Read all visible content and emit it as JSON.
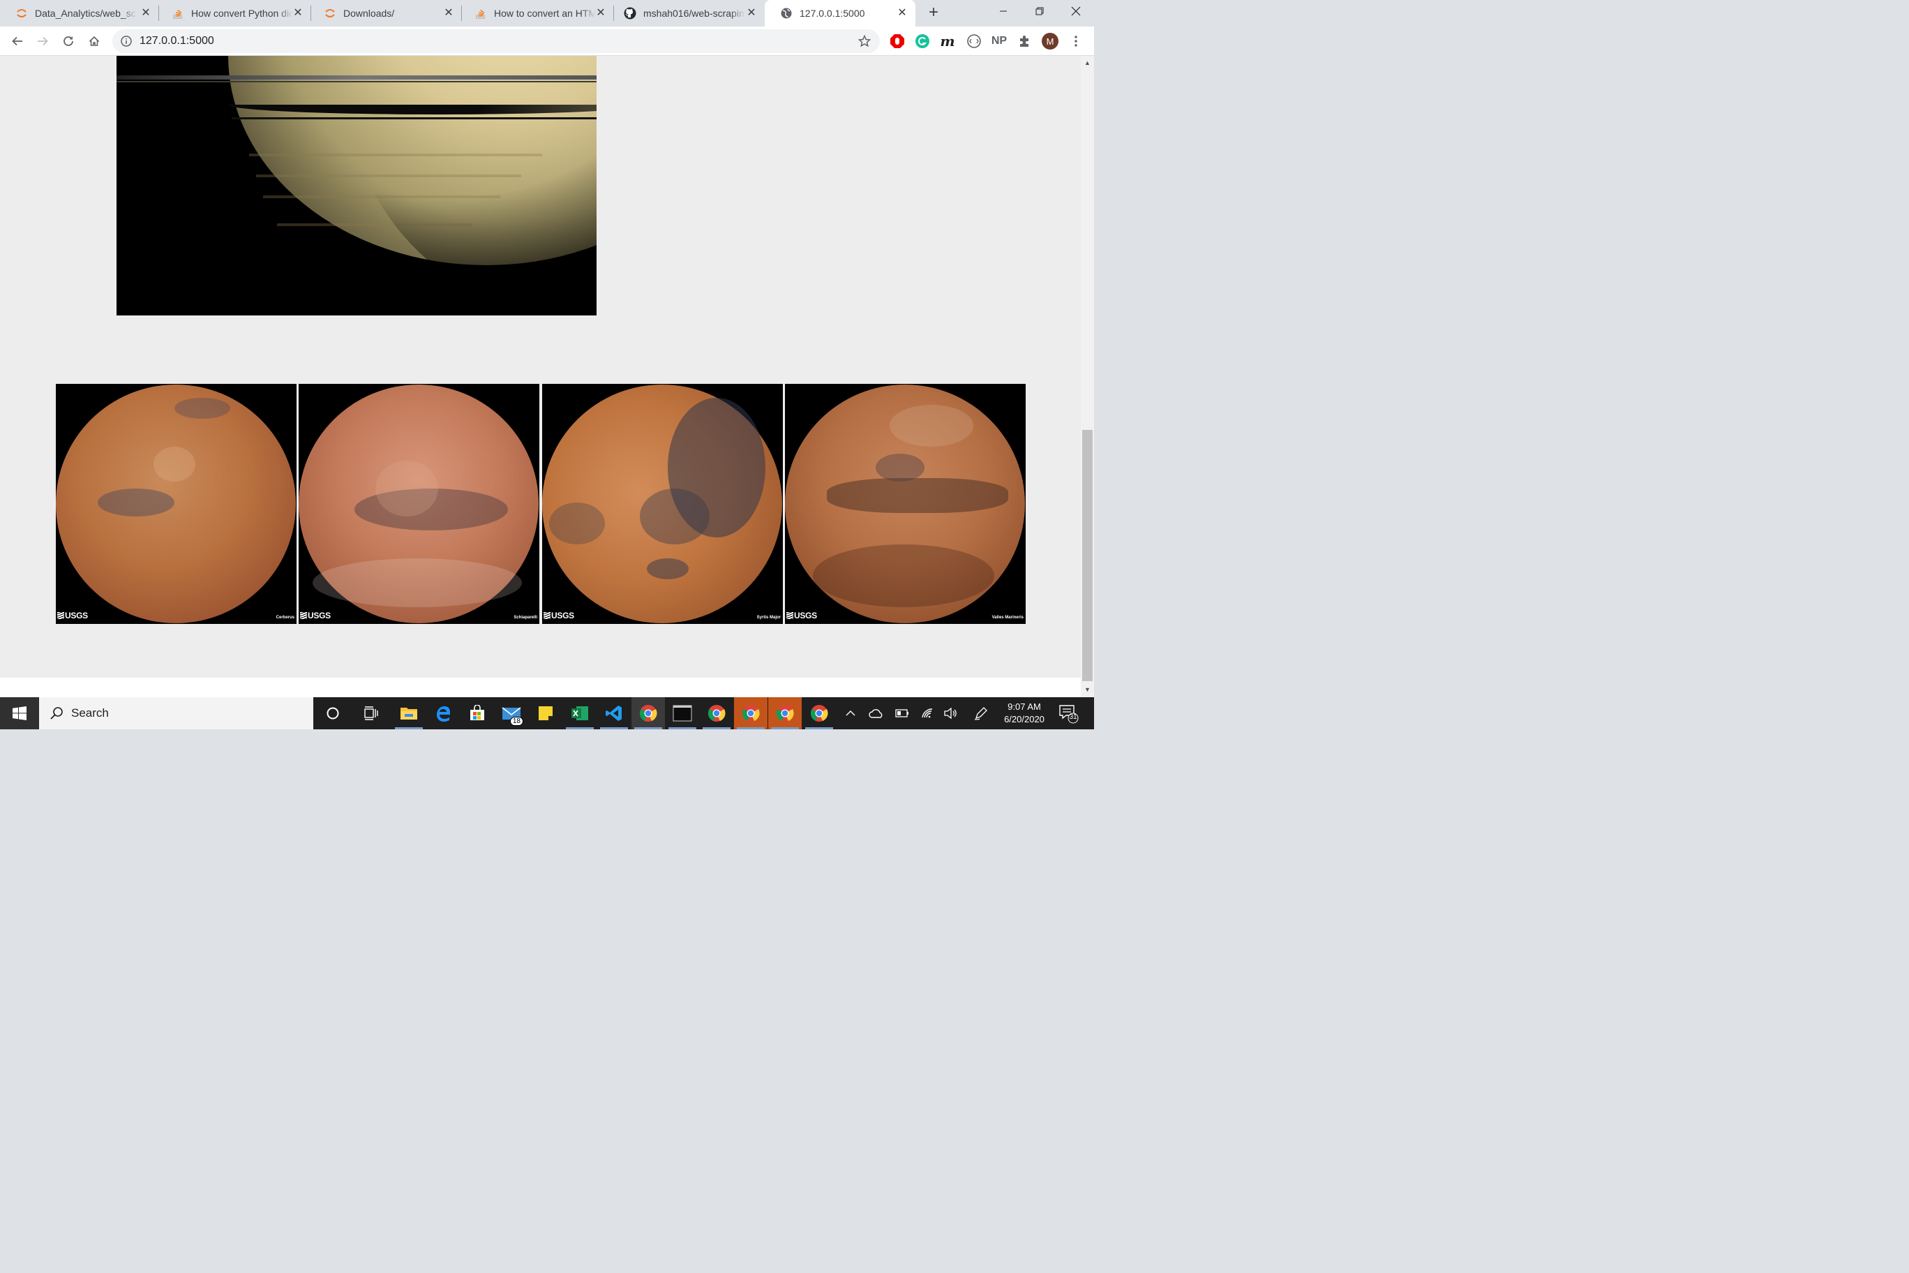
{
  "browser": {
    "tabs": [
      {
        "title": "Data_Analytics/web_scr",
        "icon": "jupyter-icon"
      },
      {
        "title": "How convert Python dic",
        "icon": "stackoverflow-icon"
      },
      {
        "title": "Downloads/",
        "icon": "jupyter-icon"
      },
      {
        "title": "How to convert an HTM",
        "icon": "stackoverflow-icon"
      },
      {
        "title": "mshah016/web-scrapin",
        "icon": "github-icon"
      },
      {
        "title": "127.0.0.1:5000",
        "icon": "globe-icon",
        "active": true
      }
    ],
    "url": "127.0.0.1:5000",
    "profile_initial": "M",
    "ext_np": "NP",
    "ext_m": "m"
  },
  "page": {
    "hemispheres": [
      {
        "name": "Cerberus"
      },
      {
        "name": "Schiaparelli"
      },
      {
        "name": "Syrtis Major"
      },
      {
        "name": "Valles Marineris"
      }
    ],
    "usgs_logo": "USGS"
  },
  "taskbar": {
    "search_placeholder": "Search",
    "mail_badge": "18",
    "time": "9:07 AM",
    "date": "6/20/2020",
    "notifications": "31"
  },
  "colors": {
    "jupyter": "#f37726",
    "stackoverflow": "#f48024",
    "taskbar": "#1f1f1f"
  }
}
